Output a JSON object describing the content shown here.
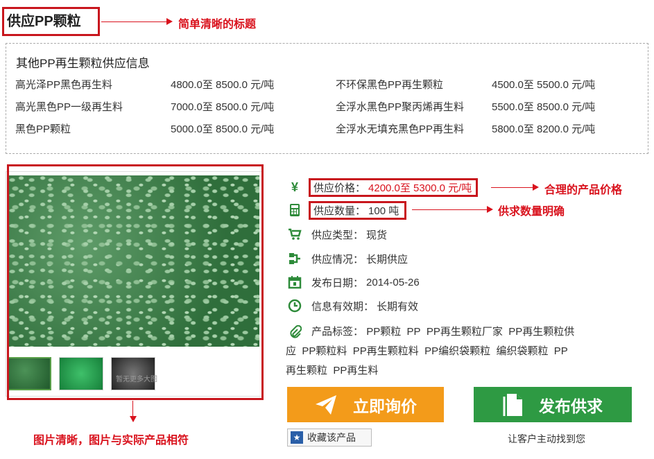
{
  "page_title": "供应PP颗粒",
  "annotations": {
    "title": "简单清晰的标题",
    "price": "合理的产品价格",
    "quantity": "供求数量明确",
    "image": "图片清晰，图片与实际产品相符"
  },
  "other_supply": {
    "heading": "其他PP再生颗粒供应信息",
    "items": [
      {
        "name": "高光泽PP黑色再生料",
        "price": "4800.0至 8500.0 元/吨"
      },
      {
        "name": "不环保黑色PP再生颗粒",
        "price": "4500.0至 5500.0 元/吨"
      },
      {
        "name": "高光黑色PP一级再生料",
        "price": "7000.0至 8500.0 元/吨"
      },
      {
        "name": "全浮水黑色PP聚丙烯再生料",
        "price": "5500.0至 8500.0 元/吨"
      },
      {
        "name": "黑色PP颗粒",
        "price": "5000.0至 8500.0 元/吨"
      },
      {
        "name": "全浮水无填充黑色PP再生料",
        "price": "5800.0至 8200.0 元/吨"
      }
    ]
  },
  "gallery": {
    "thumb_caption": "暂无更多大图"
  },
  "info": {
    "price_label": "供应价格：",
    "price_value": "4200.0至 5300.0 元/吨",
    "qty_label": "供应数量：",
    "qty_value": "100 吨",
    "type_label": "供应类型：",
    "type_value": "现货",
    "status_label": "供应情况：",
    "status_value": "长期供应",
    "date_label": "发布日期：",
    "date_value": "2014-05-26",
    "valid_label": "信息有效期：",
    "valid_value": "长期有效",
    "tags_label": "产品标签：",
    "tags": [
      "PP颗粒",
      "PP",
      "PP再生颗粒厂家",
      "PP再生颗粒供应",
      "PP颗粒料",
      "PP再生颗粒料",
      "PP编织袋颗粒",
      "编织袋颗粒",
      "PP再生颗粒",
      "PP再生料"
    ]
  },
  "actions": {
    "ask_label": "立即询价",
    "publish_label": "发布供求",
    "favorite_label": "收藏该产品",
    "tagline": "让客户主动找到您"
  },
  "icons": [
    "yen-icon",
    "calculator-icon",
    "cart-icon",
    "flow-icon",
    "calendar-icon",
    "clock-icon",
    "paperclip-icon",
    "paper-plane-icon",
    "document-icon",
    "star-icon"
  ],
  "colors": {
    "accent_red": "#c8161d",
    "ask_orange": "#f39b1a",
    "publish_green": "#2e9a43",
    "icon_green": "#2e8b3a"
  }
}
